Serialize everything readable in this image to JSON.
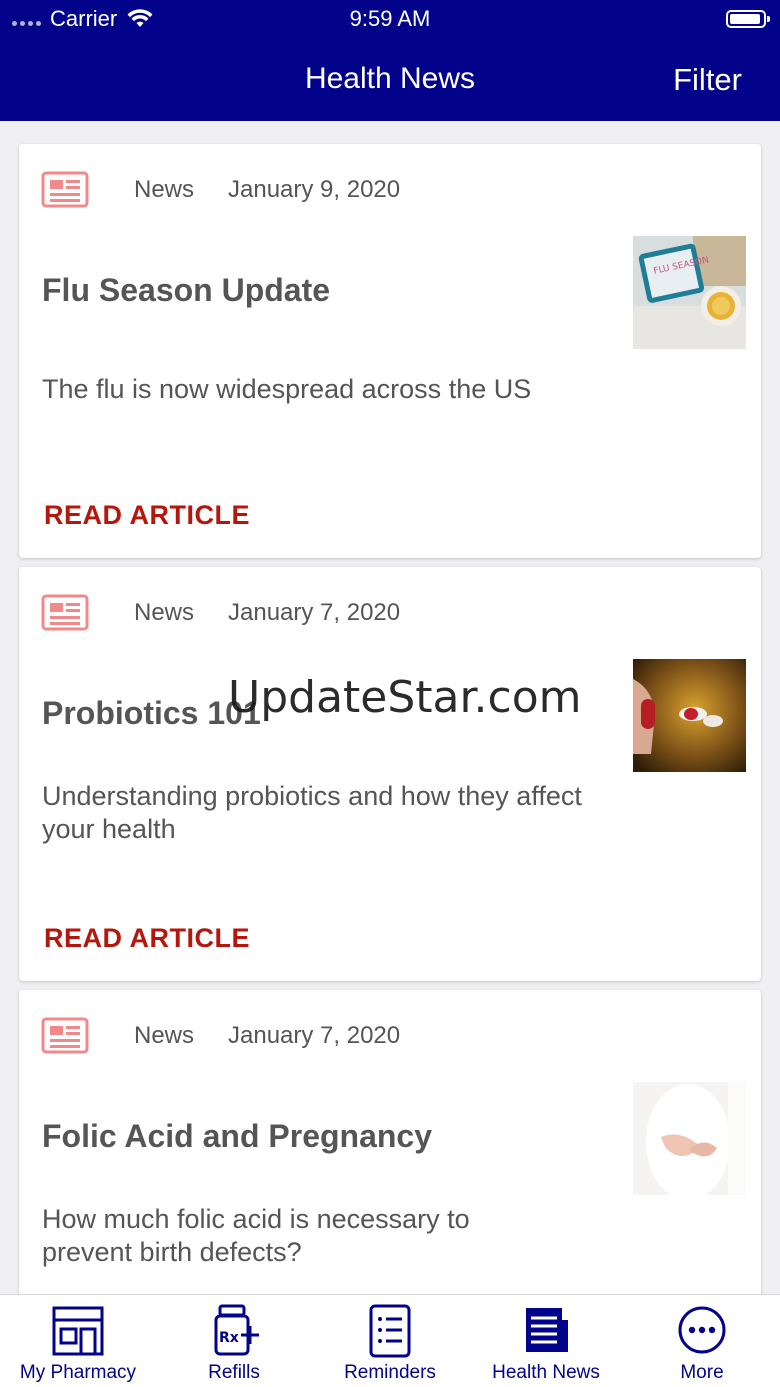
{
  "status_bar": {
    "carrier": "Carrier",
    "time": "9:59 AM"
  },
  "navbar": {
    "title": "Health News",
    "filter_label": "Filter"
  },
  "articles": [
    {
      "type": "News",
      "date": "January 9, 2020",
      "title": "Flu Season Update",
      "summary": "The flu is now widespread across the US",
      "link_label": "READ ARTICLE",
      "thumb_text": "FLU SEASON"
    },
    {
      "type": "News",
      "date": "January 7, 2020",
      "title": "Probiotics 101",
      "summary": "Understanding probiotics and how they affect your health",
      "link_label": "READ ARTICLE"
    },
    {
      "type": "News",
      "date": "January 7, 2020",
      "title": "Folic Acid and Pregnancy",
      "summary": "How much folic acid is necessary to prevent birth defects?"
    }
  ],
  "watermark": "UpdateStar.com",
  "tabbar": {
    "items": [
      {
        "label": "My Pharmacy",
        "icon": "pharmacy-icon"
      },
      {
        "label": "Refills",
        "icon": "refill-rx-icon"
      },
      {
        "label": "Reminders",
        "icon": "reminders-list-icon"
      },
      {
        "label": "Health News",
        "icon": "newspaper-icon"
      },
      {
        "label": "More",
        "icon": "more-dots-icon"
      }
    ]
  },
  "colors": {
    "primary": "#02038a",
    "link": "#b5170d",
    "icon_accent": "#f08a8a",
    "background": "#efeff4"
  }
}
